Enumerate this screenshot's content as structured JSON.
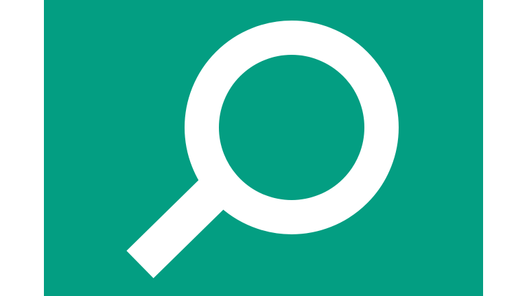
{
  "app_tile": {
    "icon": "search-icon",
    "background_color": "#039E82",
    "icon_color": "#FFFFFF",
    "page_background": "#FFFFFF"
  }
}
